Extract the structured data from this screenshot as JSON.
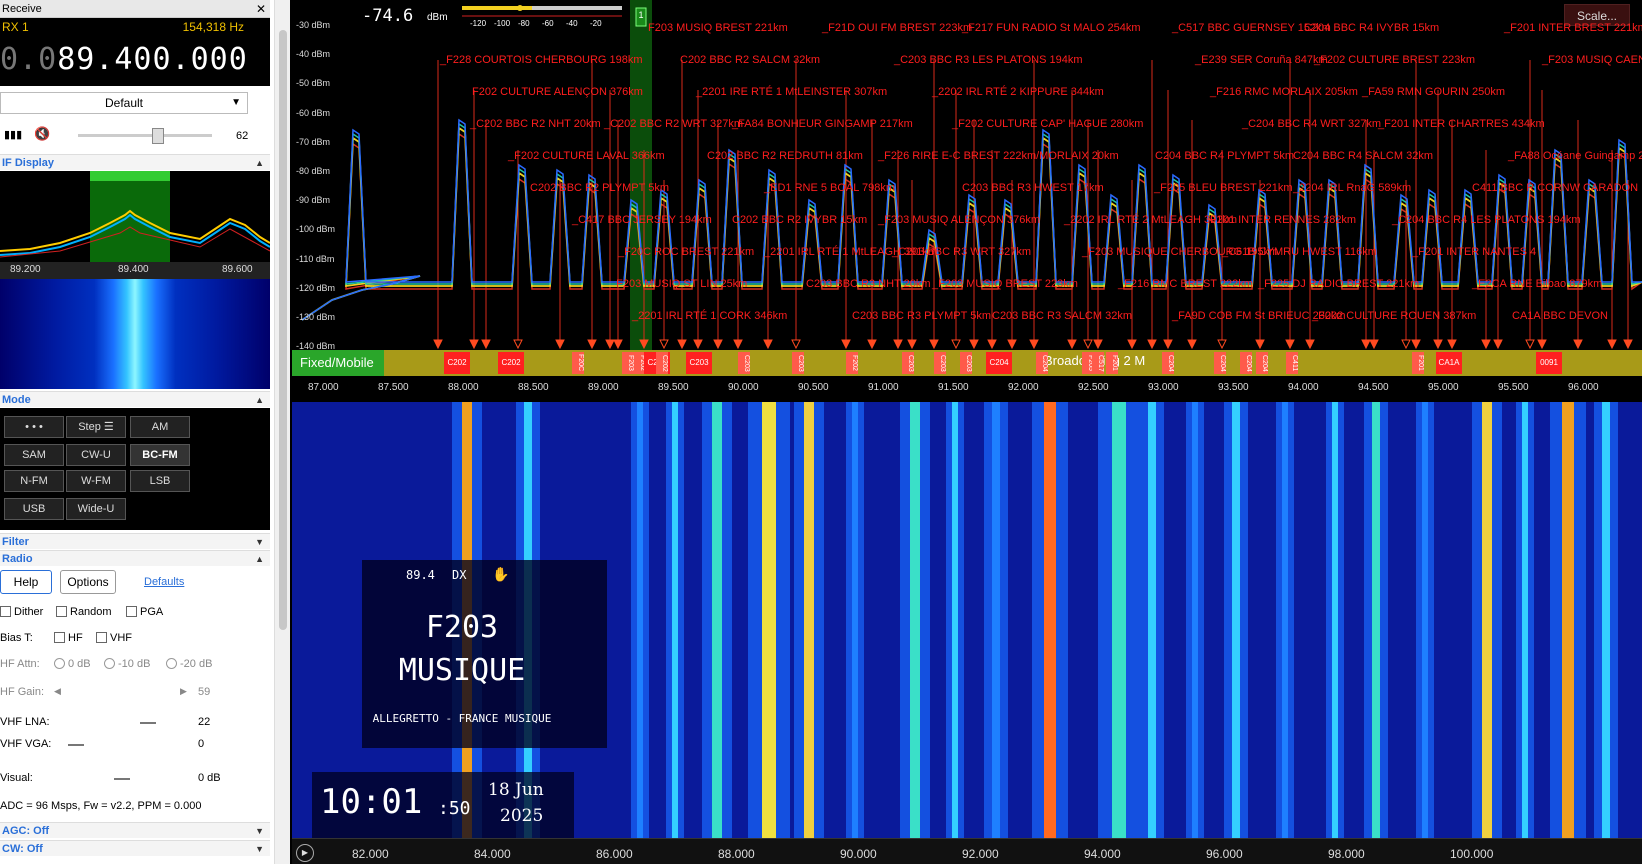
{
  "receive": {
    "title": "Receive",
    "close": "✕"
  },
  "rx": {
    "label": "RX 1",
    "hz": "154,318 Hz",
    "freq_dim": "0.0",
    "freq_main": "89.400.000"
  },
  "preset": "Default",
  "volume_value": "62",
  "if_display": {
    "title": "IF Display",
    "ticks": [
      "89.200",
      "89.400",
      "89.600"
    ]
  },
  "mode": {
    "title": "Mode",
    "buttons": [
      "• • •",
      "Step ☰",
      "AM",
      "SAM",
      "CW-U",
      "BC-FM",
      "N-FM",
      "W-FM",
      "LSB",
      "USB",
      "Wide-U"
    ],
    "selected": "BC-FM"
  },
  "filter_title": "Filter",
  "radio": {
    "title": "Radio",
    "help": "Help",
    "options": "Options",
    "defaults": "Defaults",
    "dither": "Dither",
    "random": "Random",
    "pga": "PGA",
    "bias_t": "Bias T:",
    "hf": "HF",
    "vhf": "VHF",
    "hf_attn": "HF Attn:",
    "attn0": "0 dB",
    "attn10": "-10 dB",
    "attn20": "-20 dB",
    "hf_gain": "HF Gain:",
    "hf_gain_val": "59",
    "vhf_lna": "VHF LNA:",
    "vhf_lna_val": "22",
    "vhf_vga": "VHF VGA:",
    "vhf_vga_val": "0",
    "visual": "Visual:",
    "visual_val": "0 dB",
    "adc": "ADC = 96 Msps, Fw = v2.2, PPM = 0.000"
  },
  "agc": "AGC: Off",
  "cw": "CW: Off",
  "spectrum": {
    "level": "-74.6",
    "level_unit": "dBm",
    "meter_ticks": [
      "-120",
      "-100",
      "-80",
      "-60",
      "-40",
      "-20"
    ],
    "marker": "1",
    "scale_button": "Scale...",
    "db_labels": [
      "-30 dBm",
      "-40 dBm",
      "-50 dBm",
      "-60 dBm",
      "-70 dBm",
      "-80 dBm",
      "-90 dBm",
      "-100 dBm",
      "-110 dBm",
      "-120 dBm",
      "-130 dBm",
      "-140 dBm"
    ],
    "freq_ticks": [
      "87.000",
      "87.500",
      "88.000",
      "88.500",
      "89.000",
      "89.500",
      "90.000",
      "90.500",
      "91.000",
      "91.500",
      "92.000",
      "92.500",
      "93.000",
      "93.500",
      "94.000",
      "94.500",
      "95.000",
      "95.500",
      "96.000"
    ],
    "band_fixed": "Fixed/Mobile",
    "band_broadcasting": "Broadcasting 2 M",
    "chips": [
      "C202",
      "C202",
      "F20C",
      "F203",
      "F202",
      "C203",
      "C202",
      "C203",
      "C203",
      "C203",
      "F202",
      "C203",
      "C203",
      "C203",
      "C204",
      "C204",
      "F205",
      "C517",
      "F201",
      "C204",
      "C204",
      "C204",
      "C204",
      "C411",
      "F201",
      "CA1A",
      "0091"
    ],
    "station_labels": [
      "F203 MUSIQ BREST 221km",
      "_F21D OUI FM BREST 223km",
      "_F217 FUN RADIO St MALO 254km",
      "_C517 BBC GUERNSEY 152km",
      "C204 BBC R4 IVYBR 15km",
      "_F201 INTER BREST 221km",
      "_F228 COURTOIS CHERBOURG 198km",
      "C202 BBC R2 SALCM 32km",
      "_C203 BBC R3 LES PLATONS 194km",
      "_E239 SER Coruña 847km",
      "_F202 CULTURE BREST 223km",
      "_F203 MUSIQ CAEN 2",
      "F202 CULTURE ALENÇON 376km",
      "_2201 IRE RTÉ 1 MtLEINSTER 307km",
      "_2202 IRL RTÉ 2 KIPPURE 344km",
      "_F216 RMC MORLAIX 205km",
      "_FA59 RMN GOURIN 250km",
      "_C202 BBC R2 NHT 20km",
      "_C202 BBC R2 WRT 327km",
      "_FA84 BONHEUR GINGAMP 217km",
      "_F202 CULTURE CAP' HAGUE 280km",
      "_C204 BBC R4 WRT 327km",
      "_F201 INTER CHARTRES 434km",
      "_F202 CULTURE LAVAL 366km",
      "C202 BBC R2 REDRUTH 81km",
      "_F226 RIRE E-C BREST 222km/MORLAIX 20km",
      "C204 BBC R4 PLYMPT 5km",
      "C204 BBC R4 SALCM 32km",
      "_FA88 Océane Guingamp 212km",
      "C202 BBC R2 PLYMPT 5km",
      "_ED1 RNE 5 BOAL 798km",
      "C203 BBC R3 HWEST 17km",
      "_F205 BLEU BREST 221km",
      "_2204 IRL RnaG 589km",
      "C411 BBC R CORNW CARADON",
      "_C417 BBC JERSEY 194km",
      "C202 BBC R2 IVYBR 15km",
      "_F203 MUSIQ ALENÇON 376km",
      "_2202 IRL RTÉ 2 MtLEAGH 391km",
      "F201 INTER RENNES 282km",
      "_C204 BBC R4 LES PLATONS 194km",
      "_F20C ROC BREST 221km",
      "_2201 IRL RTÉ 1 MtLEAGH 391km",
      "_C203 BBC R3 WRT 327km",
      "_F203 MUSIQUE CHERBOURG 195km",
      "_C61B CYMRU HWEST 116km",
      "_F201 INTER NANTES 4",
      "_F203 MUSIQ ST LIN 25km",
      "C203 BBC R3 NHT 20km",
      "_F203 MUSIQ BREST 223km",
      "_F216 RMC BREST 222km",
      "_F225 DJ RADIO BREST 221km",
      "_E2CA RNE Bilbao 879km",
      "_2201 IRL RTÉ 1 CORK 346km",
      "C203 BBC R3 PLYMPT 5km",
      "C203 BBC R3 SALCM 32km",
      "_FA9D COB FM St BRIEUC 230km",
      "_F202 CULTURE ROUEN 387km",
      "CA1A BBC DEVON"
    ]
  },
  "rds": {
    "freq": "89.4",
    "dx": "DX",
    "icon": "hand-icon",
    "ps_line1": "F203",
    "ps_line2": "MUSIQUE",
    "radiotext": "ALLEGRETTO - FRANCE MUSIQUE"
  },
  "clock": {
    "hm": "10:01",
    "sec": ":50",
    "date1": "18 Jun",
    "date2": "2025"
  },
  "waterfall_ticks": [
    "82.000",
    "84.000",
    "86.000",
    "88.000",
    "90.000",
    "92.000",
    "94.000",
    "96.000",
    "98.000",
    "100.000"
  ]
}
